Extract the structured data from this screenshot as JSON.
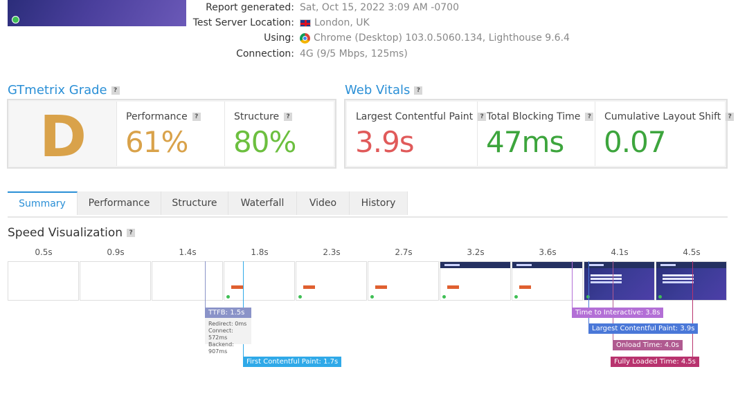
{
  "report": {
    "generated_label": "Report generated:",
    "generated_value": "Sat, Oct 15, 2022 3:09 AM -0700",
    "location_label": "Test Server Location:",
    "location_value": "London, UK",
    "using_label": "Using:",
    "using_value": "Chrome (Desktop) 103.0.5060.134, Lighthouse 9.6.4",
    "connection_label": "Connection:",
    "connection_value": "4G (9/5 Mbps, 125ms)"
  },
  "grade": {
    "title": "GTmetrix Grade",
    "letter": "D",
    "performance_label": "Performance",
    "performance_value": "61%",
    "structure_label": "Structure",
    "structure_value": "80%"
  },
  "vitals": {
    "title": "Web Vitals",
    "lcp_label": "Largest Contentful Paint",
    "lcp_value": "3.9s",
    "tbt_label": "Total Blocking Time",
    "tbt_value": "47ms",
    "cls_label": "Cumulative Layout Shift",
    "cls_value": "0.07"
  },
  "tabs": [
    "Summary",
    "Performance",
    "Structure",
    "Waterfall",
    "Video",
    "History"
  ],
  "speed": {
    "title": "Speed Visualization",
    "times": [
      "0.5s",
      "0.9s",
      "1.4s",
      "1.8s",
      "2.3s",
      "2.7s",
      "3.2s",
      "3.6s",
      "4.1s",
      "4.5s"
    ],
    "ttfb": {
      "label": "TTFB: 1.5s",
      "redirect": "Redirect: 0ms",
      "connect": "Connect: 572ms",
      "backend": "Backend: 907ms"
    },
    "fcp": "First Contentful Paint: 1.7s",
    "tti": "Time to Interactive: 3.8s",
    "lcp": "Largest Contentful Paint: 3.9s",
    "onload": "Onload Time: 4.0s",
    "fully_loaded": "Fully Loaded Time: 4.5s"
  },
  "colors": {
    "accent": "#2a8fd6",
    "grade": "#d9a24a",
    "performance": "#d9a24a",
    "good": "#3da53d",
    "bad": "#e05a5a",
    "ttfb": "#8a93c8",
    "fcp": "#2fa9e8",
    "tti": "#b36fd6",
    "lcp": "#4a78d8",
    "onload": "#b05a90",
    "fully_loaded": "#b8336e"
  }
}
